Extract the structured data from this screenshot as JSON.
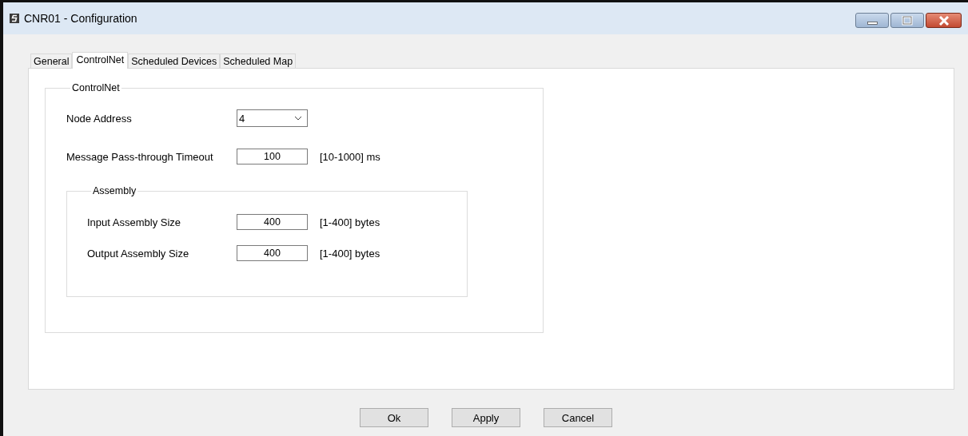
{
  "window": {
    "title": "CNR01 - Configuration"
  },
  "tabs": [
    {
      "label": "General",
      "selected": false
    },
    {
      "label": "ControlNet",
      "selected": true
    },
    {
      "label": "Scheduled Devices",
      "selected": false
    },
    {
      "label": "Scheduled Map",
      "selected": false
    }
  ],
  "controlnet_group": {
    "title": "ControlNet",
    "node_address": {
      "label": "Node Address",
      "value": "4"
    },
    "timeout": {
      "label": "Message Pass-through Timeout",
      "value": "100",
      "unit": "[10-1000] ms"
    },
    "assembly": {
      "title": "Assembly",
      "fields": [
        {
          "label": "Input Assembly Size",
          "value": "400",
          "unit": "[1-400] bytes"
        },
        {
          "label": "Output Assembly Size",
          "value": "400",
          "unit": "[1-400] bytes"
        }
      ]
    }
  },
  "buttons": [
    "Ok",
    "Apply",
    "Cancel"
  ]
}
